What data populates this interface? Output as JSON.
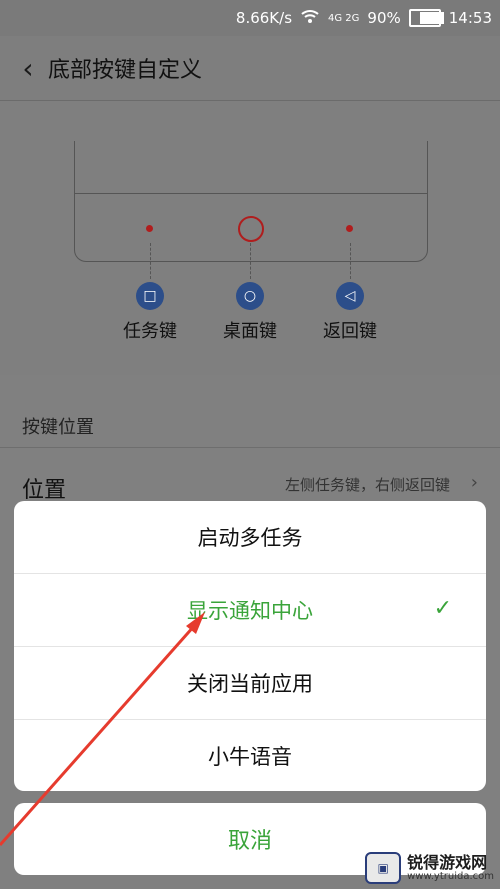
{
  "status": {
    "speed": "8.66K/s",
    "network": "4G 2G",
    "battery": "90%",
    "time": "14:53"
  },
  "header": {
    "title": "底部按键自定义"
  },
  "preview": {
    "keys": [
      {
        "label": "任务键",
        "icon": "square-icon"
      },
      {
        "label": "桌面键",
        "icon": "circle-icon"
      },
      {
        "label": "返回键",
        "icon": "triangle-icon"
      }
    ]
  },
  "settings": {
    "section_title": "按键位置",
    "position_label": "位置",
    "position_value": "左侧任务键，右侧返回键"
  },
  "sheet": {
    "options": [
      {
        "label": "启动多任务",
        "selected": false
      },
      {
        "label": "显示通知中心",
        "selected": true
      },
      {
        "label": "关闭当前应用",
        "selected": false
      },
      {
        "label": "小牛语音",
        "selected": false
      }
    ],
    "cancel": "取消"
  },
  "watermark": {
    "title": "锐得游戏网",
    "url": "www.ytruida.com"
  },
  "colors": {
    "accent": "#3aa43a",
    "indicator": "#b01d1d",
    "key_icon": "#2c4e8a"
  }
}
